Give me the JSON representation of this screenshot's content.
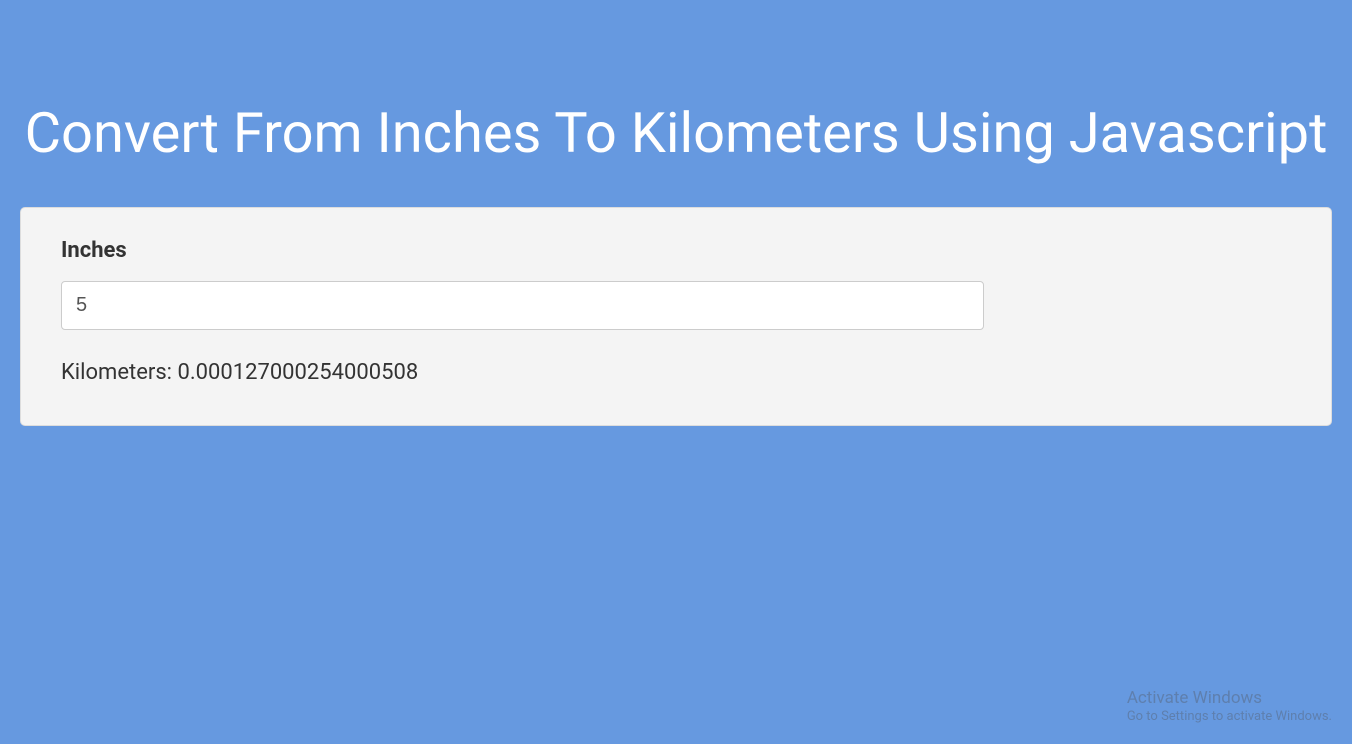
{
  "header": {
    "title": "Convert From Inches To Kilometers Using Javascript"
  },
  "form": {
    "inches_label": "Inches",
    "inches_value": "5",
    "inches_placeholder": ""
  },
  "result": {
    "text": "Kilometers: 0.000127000254000508"
  },
  "watermark": {
    "line1": "Activate Windows",
    "line2": "Go to Settings to activate Windows."
  }
}
